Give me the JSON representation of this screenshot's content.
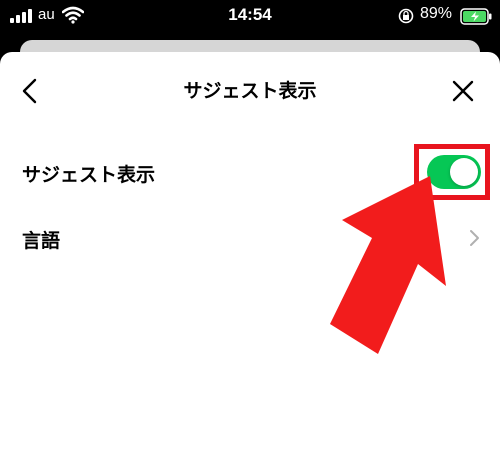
{
  "status_bar": {
    "carrier": "au",
    "time": "14:54",
    "battery_percent": "89%"
  },
  "header": {
    "title": "サジェスト表示"
  },
  "settings": {
    "suggest_label": "サジェスト表示",
    "suggest_enabled": true,
    "language_label": "言語"
  },
  "colors": {
    "toggle_on": "#06c755",
    "highlight": "#e8141e"
  }
}
